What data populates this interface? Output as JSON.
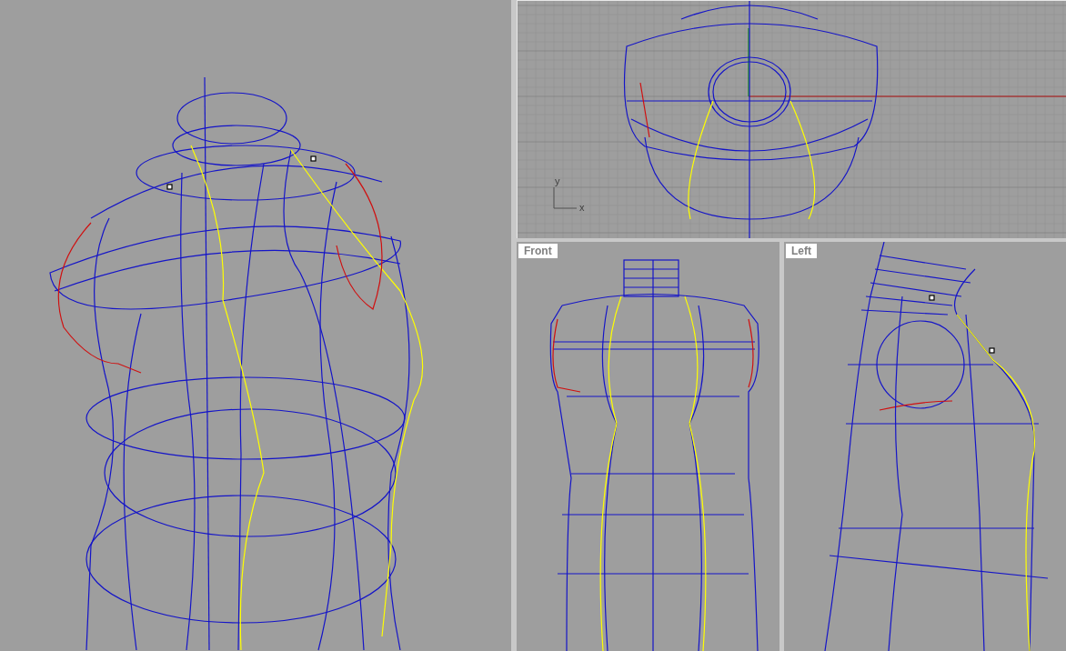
{
  "viewports": [
    {
      "kind": "perspective"
    },
    {
      "kind": "top",
      "axis_x": "x",
      "axis_y": "y"
    },
    {
      "kind": "front",
      "label": "Front"
    },
    {
      "kind": "left",
      "label": "Left"
    }
  ]
}
